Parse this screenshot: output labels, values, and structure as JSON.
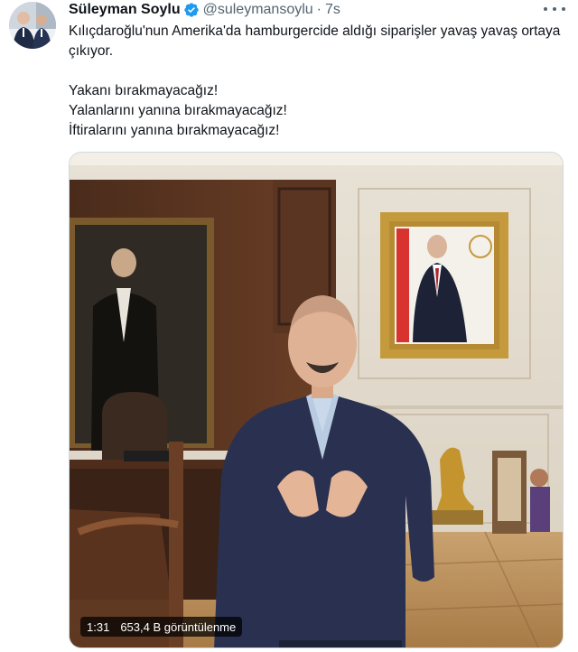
{
  "author": {
    "display_name": "Süleyman Soylu",
    "handle": "@suleymansoylu",
    "separator": "·",
    "time": "7s",
    "verified": true
  },
  "tweet": {
    "lines": [
      "Kılıçdaroğlu'nun Amerika'da hamburgercide aldığı siparişler yavaş yavaş ortaya çıkıyor.",
      "Yakanı bırakmayacağız!",
      "Yalanlarını yanına bırakmayacağız!",
      "İftiralarını yanına bırakmayacağız!"
    ]
  },
  "media": {
    "type": "video",
    "duration": "1:31",
    "views": "653,4 B görüntülenme"
  },
  "icons": {
    "verified": "verified-badge-icon",
    "more": "more-options-icon"
  },
  "colors": {
    "text": "#0f1419",
    "secondary": "#536471",
    "verified_blue": "#1d9bf0",
    "border": "#cfd9de"
  }
}
